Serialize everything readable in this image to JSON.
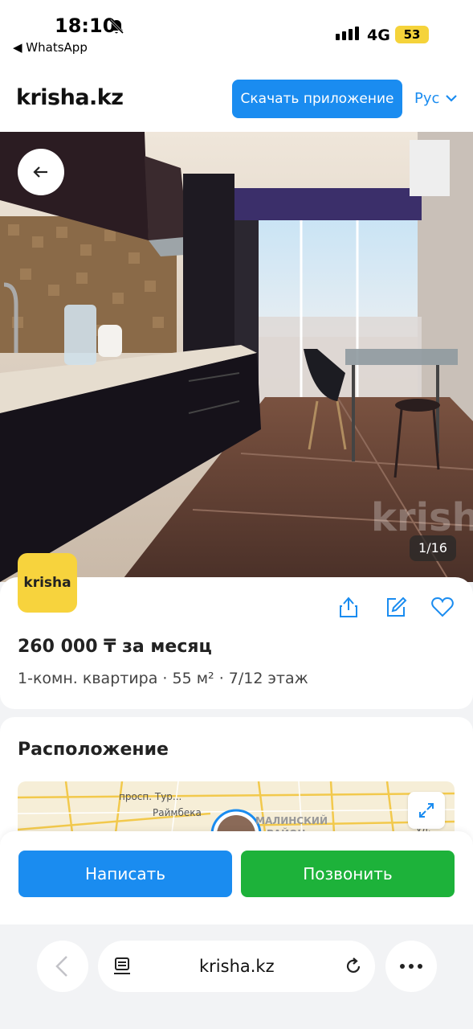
{
  "status_bar": {
    "time": "18:10",
    "back_app": "◀ WhatsApp",
    "network": "4G",
    "battery": "53"
  },
  "header": {
    "logo": "krisha.kz",
    "download_button": "Скачать приложение",
    "language": "Рус"
  },
  "gallery": {
    "counter": "1/16",
    "watermark": "krisha"
  },
  "listing": {
    "badge": "krisha",
    "price": "260 000 ₸ за месяц",
    "details": "1-комн. квартира · 55 м² · 7/12 этаж"
  },
  "location": {
    "title": "Расположение",
    "map_labels": [
      "просп. Тур...",
      "Раймбека",
      "МАЛИНСКИЙ",
      "РАЙОН",
      "ул."
    ]
  },
  "actions": {
    "write": "Написать",
    "call": "Позвонить"
  },
  "browser": {
    "url": "krisha.kz"
  },
  "colors": {
    "accent_blue": "#1a8cf0",
    "call_green": "#1db23a",
    "badge_yellow": "#f7d33d"
  }
}
